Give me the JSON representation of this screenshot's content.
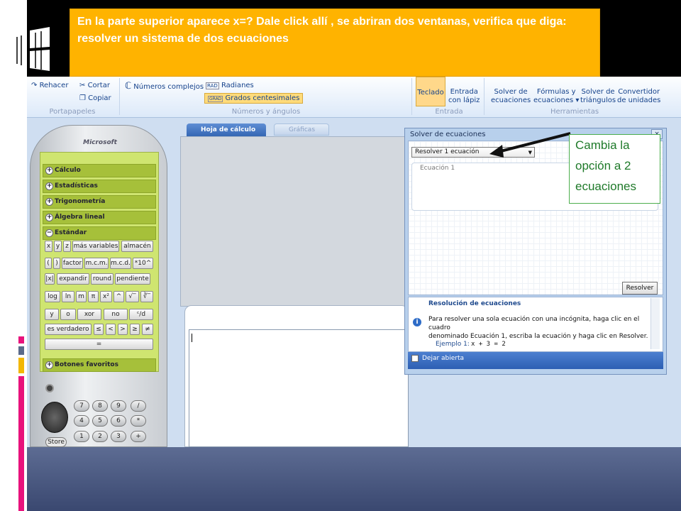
{
  "callout_top": {
    "text": "En la parte superior aparece  x=? Dale click allí , se abriran dos ventanas, verifica que diga: resolver un sistema de dos  ecuaciones"
  },
  "callout_side": {
    "text": "Cambia la opción a 2 ecuaciones"
  },
  "ribbon": {
    "rehacer": "Rehacer",
    "cortar": "Cortar",
    "copiar": "Copiar",
    "portapapeles": "Portapapeles",
    "numeros_complejos": "Números complejos",
    "rad_badge": "RAD",
    "radianes": "Radianes",
    "grad_badge": "GRAD",
    "grados_centesimales": "Grados centesimales",
    "numeros_angulos": "Números y ángulos",
    "teclado": "Teclado",
    "entrada_lapiz_1": "Entrada",
    "entrada_lapiz_2": "con lápiz",
    "entrada": "Entrada",
    "solver_1": "Solver de",
    "solver_2": "ecuaciones",
    "formulas_1": "Fórmulas y",
    "formulas_2": "ecuaciones ▾",
    "triangulos_1": "Solver de",
    "triangulos_2": "triángulos",
    "convertidor_1": "Convertidor",
    "convertidor_2": "de unidades",
    "herramientas": "Herramientas"
  },
  "calculator": {
    "brand": "Microsoft",
    "categories": [
      "Cálculo",
      "Estadísticas",
      "Trigonometría",
      "Álgebra lineal",
      "Estándar",
      "Botones favoritos"
    ],
    "keys_row1": [
      "x",
      "y",
      "z",
      "más variables",
      "almacén"
    ],
    "keys_row2": [
      "(",
      ")",
      "factor",
      "m.c.m.",
      "m.c.d.",
      "*10^"
    ],
    "keys_row3": [
      "|x|",
      "expandir",
      "round",
      "pendiente"
    ],
    "keys_row4": [
      "log",
      "ln",
      "m",
      "π",
      "x²",
      "^",
      "√‾",
      "∛‾"
    ],
    "keys_row5": [
      "y",
      "o",
      "xor",
      "no",
      "ᶜ/d"
    ],
    "keys_row6": [
      "es verdadero",
      "≤",
      "<",
      ">",
      "≥",
      "≠"
    ],
    "equals": "=",
    "numpad": [
      "7",
      "8",
      "9",
      "/",
      "4",
      "5",
      "6",
      "*",
      "1",
      "2",
      "3",
      "+"
    ],
    "store": "Store"
  },
  "worksheet": {
    "tab_hoja": "Hoja de cálculo",
    "tab_graficas": "Gráficas"
  },
  "solver": {
    "title": "Solver de ecuaciones",
    "close": "×",
    "select_value": "Resolver 1 ecuación",
    "equation_label": "Ecuación 1",
    "resolver_button": "Resolver",
    "help_title": "Resolución de ecuaciones",
    "help_text_1": "Para resolver una sola ecuación con una incógnita, haga clic en el cuadro",
    "help_text_2": "denominado Ecuación 1, escriba la ecuación y haga clic en Resolver.",
    "example_label": "Ejemplo 1:",
    "example_eq": "x + 3 = 2",
    "keep_open": "Dejar abierta"
  },
  "colors": {
    "callout_orange": "#ffb300",
    "callout_green": "#1f7a2a",
    "calc_green": "#cfe570"
  }
}
